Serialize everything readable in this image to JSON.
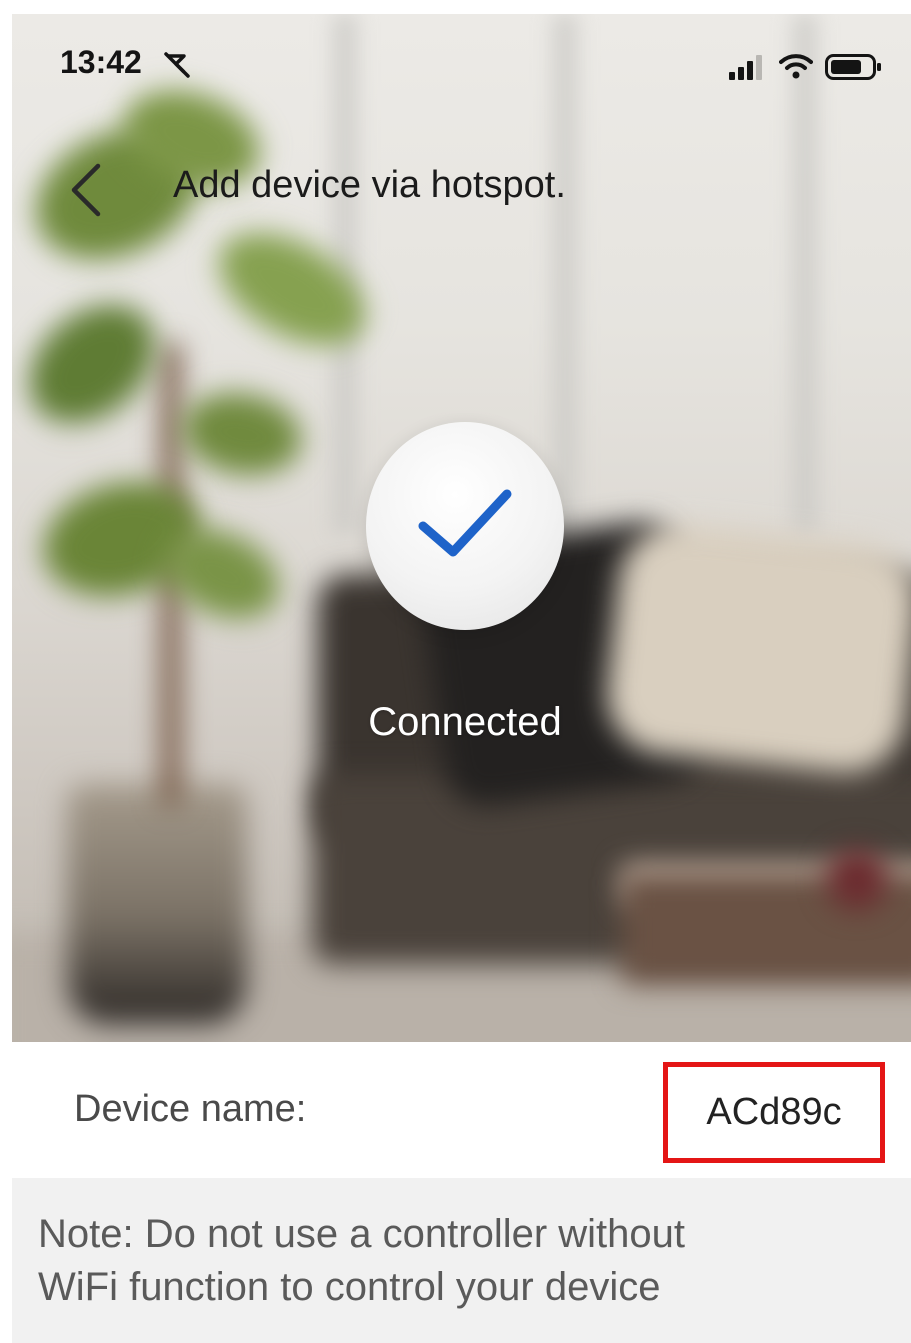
{
  "status_bar": {
    "time": "13:42",
    "icons": [
      "mute-icon",
      "signal-icon",
      "wifi-icon",
      "battery-icon"
    ]
  },
  "header": {
    "back_icon": "chevron-left-icon",
    "title": "Add device via hotspot."
  },
  "status": {
    "icon": "checkmark-icon",
    "label": "Connected",
    "accent_color": "#1e63c9"
  },
  "device": {
    "label": "Device name:",
    "value": "ACd89c",
    "highlight_color": "#e41515"
  },
  "note": {
    "text_line1": "Note: Do not use a controller without",
    "text_line2": "WiFi function to control your device"
  }
}
